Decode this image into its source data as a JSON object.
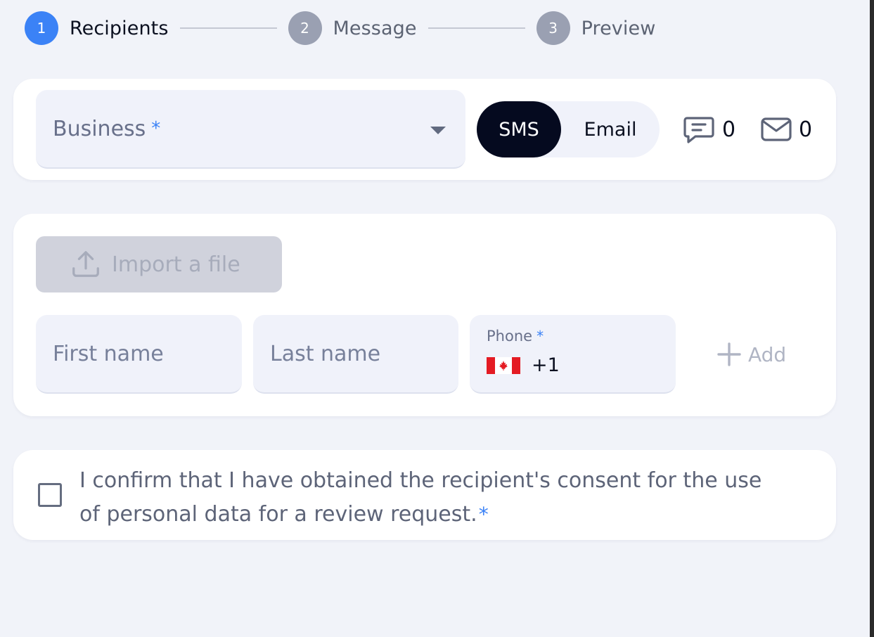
{
  "stepper": {
    "steps": [
      {
        "number": "1",
        "label": "Recipients",
        "state": "active"
      },
      {
        "number": "2",
        "label": "Message",
        "state": "inactive"
      },
      {
        "number": "3",
        "label": "Preview",
        "state": "inactive"
      }
    ]
  },
  "business_select": {
    "label": "Business",
    "required_mark": "*"
  },
  "channel_toggle": {
    "sms_label": "SMS",
    "email_label": "Email",
    "selected": "SMS"
  },
  "counters": {
    "sms_count": "0",
    "email_count": "0"
  },
  "import": {
    "label": "Import a file"
  },
  "recipient_form": {
    "first_name_placeholder": "First name",
    "last_name_placeholder": "Last name",
    "phone_label": "Phone",
    "phone_required_mark": "*",
    "phone_country_code": "+1",
    "add_label": "Add"
  },
  "consent": {
    "text": "I confirm that I have obtained the recipient's consent for the use of personal data for a review request.",
    "required_mark": "*"
  },
  "colors": {
    "accent": "#3b82f6",
    "dark": "#050a1f",
    "background": "#f1f3f9"
  },
  "icons": [
    "chevron-down-icon",
    "message-icon",
    "mail-icon",
    "upload-icon",
    "canada-flag-icon",
    "plus-icon"
  ]
}
